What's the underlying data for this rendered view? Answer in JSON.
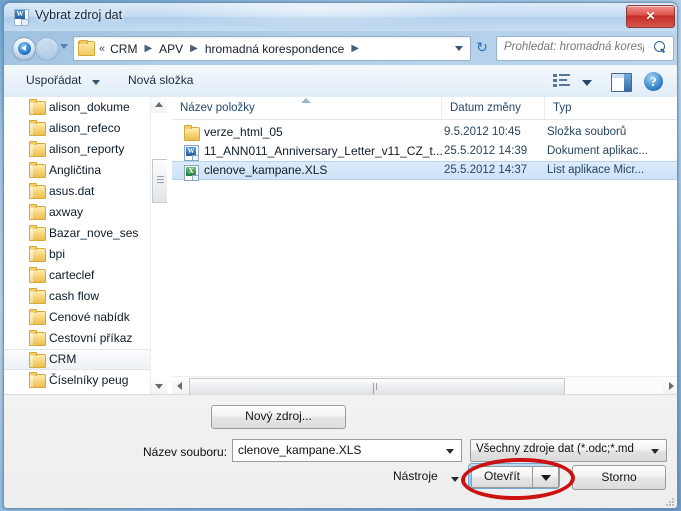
{
  "window": {
    "title": "Vybrat zdroj dat",
    "app_icon": "word-document-icon",
    "close_label": "✕"
  },
  "nav": {
    "back_tooltip": "Zpět",
    "forward_tooltip": "Vpřed",
    "breadcrumb_overflow": "«",
    "breadcrumb": [
      {
        "label": "CRM"
      },
      {
        "label": "APV"
      },
      {
        "label": "hromadná korespondence"
      }
    ],
    "refresh_icon": "refresh-icon",
    "search_placeholder": "Prohledat: hromadná korespo..."
  },
  "toolbar": {
    "organize_label": "Uspořádat",
    "new_folder_label": "Nová složka",
    "view_icon": "list-view-icon",
    "preview_pane_icon": "preview-pane-icon",
    "help_icon": "help-icon",
    "help_glyph": "?"
  },
  "nav_pane": {
    "items": [
      {
        "label": "alison_dokume",
        "selected": false
      },
      {
        "label": "alison_refeco",
        "selected": false
      },
      {
        "label": "alison_reporty",
        "selected": false
      },
      {
        "label": "Angličtina",
        "selected": false
      },
      {
        "label": "asus.dat",
        "selected": false
      },
      {
        "label": "axway",
        "selected": false
      },
      {
        "label": "Bazar_nove_ses",
        "selected": false
      },
      {
        "label": "bpi",
        "selected": false
      },
      {
        "label": "carteclef",
        "selected": false
      },
      {
        "label": "cash flow",
        "selected": false
      },
      {
        "label": "Cenové nabídk",
        "selected": false
      },
      {
        "label": "Cestovní příkaz",
        "selected": false
      },
      {
        "label": "CRM",
        "selected": true
      },
      {
        "label": "Číselníky peug",
        "selected": false
      }
    ]
  },
  "file_list": {
    "columns": [
      {
        "label": "Název položky",
        "sorted": true
      },
      {
        "label": "Datum změny",
        "sorted": false
      },
      {
        "label": "Typ",
        "sorted": false
      }
    ],
    "rows": [
      {
        "icon": "folder-icon",
        "name": "verze_html_05",
        "date": "9.5.2012 10:45",
        "type": "Složka souborů",
        "selected": false
      },
      {
        "icon": "word-document-icon",
        "glyph": "W",
        "name": "11_ANN011_Anniversary_Letter_v11_CZ_t...",
        "date": "25.5.2012 14:39",
        "type": "Dokument aplikac...",
        "selected": false
      },
      {
        "icon": "excel-document-icon",
        "glyph": "X",
        "name": "clenove_kampane.XLS",
        "date": "25.5.2012 14:37",
        "type": "List aplikace Micr...",
        "selected": true
      }
    ]
  },
  "footer": {
    "new_source_label": "Nový zdroj...",
    "filename_label": "Název souboru:",
    "filename_value": "clenove_kampane.XLS",
    "filetype_value": "Všechny zdroje dat (*.odc;*.md",
    "tools_label": "Nástroje",
    "open_label": "Otevřít",
    "cancel_label": "Storno"
  },
  "colors": {
    "accent_blue": "#2f6ca6",
    "selection_blue": "#cde2f7",
    "annotation_red": "#cc1111",
    "folder_yellow": "#f7d273",
    "close_red": "#c62d28"
  }
}
